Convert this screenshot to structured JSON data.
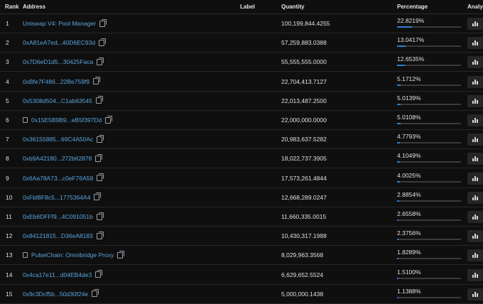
{
  "headers": {
    "rank": "Rank",
    "address": "Address",
    "label": "Label",
    "quantity": "Quantity",
    "percentage": "Percentage",
    "analytics": "Analyti"
  },
  "rows": [
    {
      "rank": "1",
      "address": "Uniswap V4: Pool Manager",
      "quantity": "100,199,844.4255",
      "percentage": "22.8219%",
      "pct_value": 22.8219,
      "lead_icon": "",
      "copy_icon": "copy-icon"
    },
    {
      "rank": "2",
      "address": "0xA81eA7ed...40D6EC93d",
      "quantity": "57,259,883.0388",
      "percentage": "13.0417%",
      "pct_value": 13.0417,
      "lead_icon": "",
      "copy_icon": "copy-icon"
    },
    {
      "rank": "3",
      "address": "0x7D6eD1d5...30425Faca",
      "quantity": "55,555,555.0000",
      "percentage": "12.6535%",
      "pct_value": 12.6535,
      "lead_icon": "",
      "copy_icon": "copy-icon"
    },
    {
      "rank": "4",
      "address": "0xBfe7F486...22Be759f9",
      "quantity": "22,704,413.7127",
      "percentage": "5.1712%",
      "pct_value": 5.1712,
      "lead_icon": "",
      "copy_icon": "copy-icon"
    },
    {
      "rank": "5",
      "address": "0x5308d504...C1ab63545",
      "quantity": "22,013,487.2500",
      "percentage": "5.0139%",
      "pct_value": 5.0139,
      "lead_icon": "",
      "copy_icon": "copy-icon"
    },
    {
      "rank": "6",
      "address": "0x15E5B9B9...eB5f397Dd",
      "quantity": "22,000,000.0000",
      "percentage": "5.0108%",
      "pct_value": 5.0108,
      "lead_icon": "contract-icon",
      "copy_icon": "copy-icon"
    },
    {
      "rank": "7",
      "address": "0x36155885...69C4A50Ac",
      "quantity": "20,983,637.5282",
      "percentage": "4.7793%",
      "pct_value": 4.7793,
      "lead_icon": "",
      "copy_icon": "copy-icon"
    },
    {
      "rank": "8",
      "address": "0xb9A42180...272b62878",
      "quantity": "18,022,737.3905",
      "percentage": "4.1049%",
      "pct_value": 4.1049,
      "lead_icon": "",
      "copy_icon": "copy-icon"
    },
    {
      "rank": "9",
      "address": "0x6Aa78A73...c0eF76A58",
      "quantity": "17,573,261.4844",
      "percentage": "4.0025%",
      "pct_value": 4.0025,
      "lead_icon": "",
      "copy_icon": "copy-icon"
    },
    {
      "rank": "10",
      "address": "0xFbf8F8c5...1775364A4",
      "quantity": "12,668,289.0247",
      "percentage": "2.8854%",
      "pct_value": 2.8854,
      "lead_icon": "",
      "copy_icon": "copy-icon"
    },
    {
      "rank": "11",
      "address": "0xEb6DFFf9...4C091051b",
      "quantity": "11,660,335.0015",
      "percentage": "2.6558%",
      "pct_value": 2.6558,
      "lead_icon": "",
      "copy_icon": "copy-icon"
    },
    {
      "rank": "12",
      "address": "0x84121815...D36eA8183",
      "quantity": "10,430,317.1988",
      "percentage": "2.3756%",
      "pct_value": 2.3756,
      "lead_icon": "",
      "copy_icon": "copy-icon"
    },
    {
      "rank": "13",
      "address": "PulseChain: Omnibridge Proxy",
      "quantity": "8,029,963.3568",
      "percentage": "1.8289%",
      "pct_value": 1.8289,
      "lead_icon": "contract-icon",
      "copy_icon": "copy-icon"
    },
    {
      "rank": "14",
      "address": "0x4ca17e11...d04EB4de3",
      "quantity": "6,629,652.5524",
      "percentage": "1.5100%",
      "pct_value": 1.51,
      "lead_icon": "",
      "copy_icon": "copy-icon"
    },
    {
      "rank": "15",
      "address": "0x9c3Dcf5b...50d30f24e",
      "quantity": "5,000,000.1438",
      "percentage": "1.1388%",
      "pct_value": 1.1388,
      "lead_icon": "",
      "copy_icon": "copy-icon"
    }
  ],
  "analytics_icon": "bar-chart-icon",
  "colors": {
    "link": "#58a6e0",
    "bar_fill": "#2f7fd1",
    "bar_track": "#3a3a3a",
    "background": "#0f0f0f"
  }
}
